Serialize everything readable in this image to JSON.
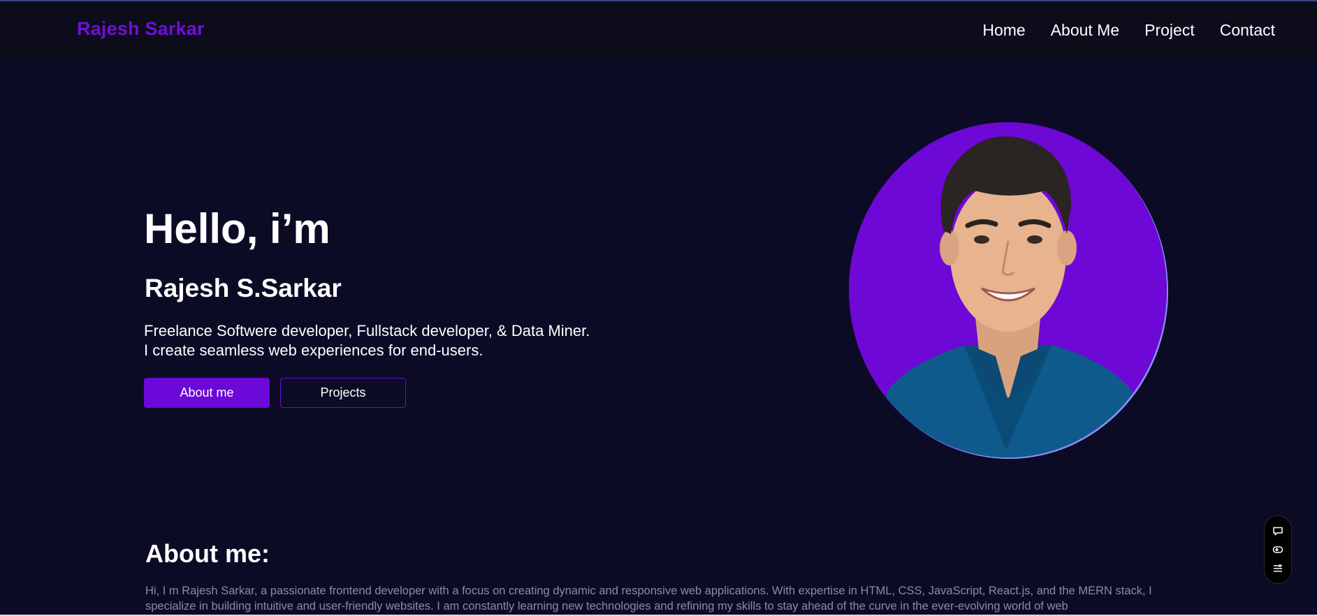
{
  "header": {
    "brand": "Rajesh Sarkar",
    "nav": [
      {
        "label": "Home"
      },
      {
        "label": "About Me"
      },
      {
        "label": "Project"
      },
      {
        "label": "Contact"
      }
    ]
  },
  "hero": {
    "greeting": "Hello, i’m",
    "name": "Rajesh S.Sarkar",
    "description_line1": "Freelance Softwere developer, Fullstack developer, & Data Miner.",
    "description_line2": "I create seamless web experiences for end-users.",
    "primary_button": "About me",
    "secondary_button": "Projects"
  },
  "about": {
    "title": "About me:",
    "text": "Hi, I m Rajesh Sarkar, a passionate frontend developer with a focus on creating dynamic and responsive web applications. With expertise in HTML, CSS, JavaScript, React.js, and the MERN stack, I specialize in building intuitive and user-friendly websites. I am constantly learning new technologies and refining my skills to stay ahead of the curve in the ever-evolving world of web"
  },
  "floating_widget": {
    "icons": [
      "chat-icon",
      "eye-icon",
      "menu-icon"
    ]
  },
  "colors": {
    "background": "#0b0b26",
    "header_background": "#0d0c1b",
    "accent": "#6c08d8",
    "brand": "#6f0fd6",
    "muted_text": "#8c8c9e"
  }
}
